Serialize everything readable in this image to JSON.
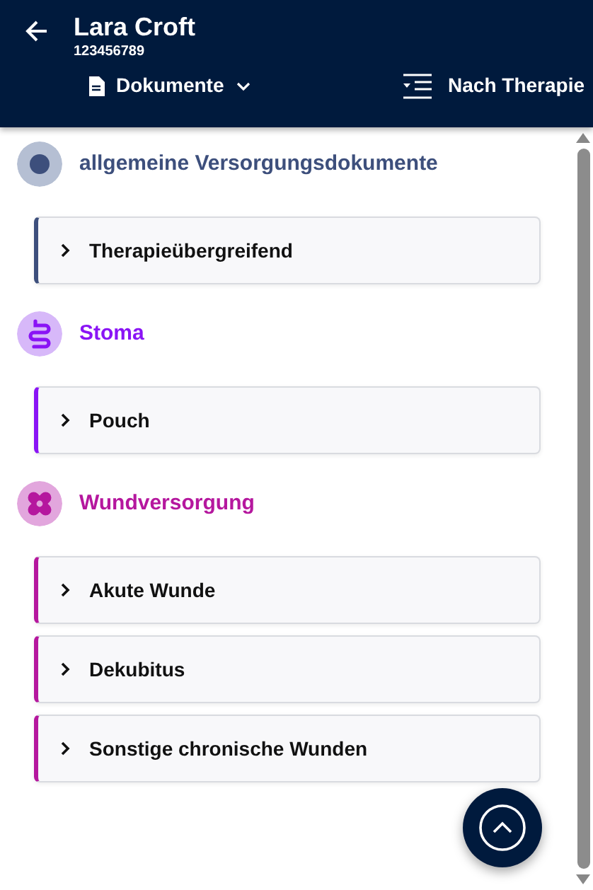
{
  "header": {
    "name": "Lara Croft",
    "id_number": "123456789",
    "view_selector": "Dokumente",
    "sort_button": "Nach Therapie"
  },
  "groups": [
    {
      "title": "allgemeine Versorgungsdokumente",
      "kind": "general",
      "color": "#3d4f7c",
      "items": [
        {
          "label": "Therapieübergreifend",
          "expanded": false
        }
      ]
    },
    {
      "title": "Stoma",
      "kind": "stoma",
      "color": "#8a14f5",
      "items": [
        {
          "label": "Pouch",
          "expanded": false
        }
      ]
    },
    {
      "title": "Wundversorgung",
      "kind": "wound",
      "color": "#b5179e",
      "items": [
        {
          "label": "Akute Wunde",
          "expanded": false
        },
        {
          "label": "Dekubitus",
          "expanded": false
        },
        {
          "label": "Sonstige chronische Wunden",
          "expanded": false
        }
      ]
    }
  ]
}
